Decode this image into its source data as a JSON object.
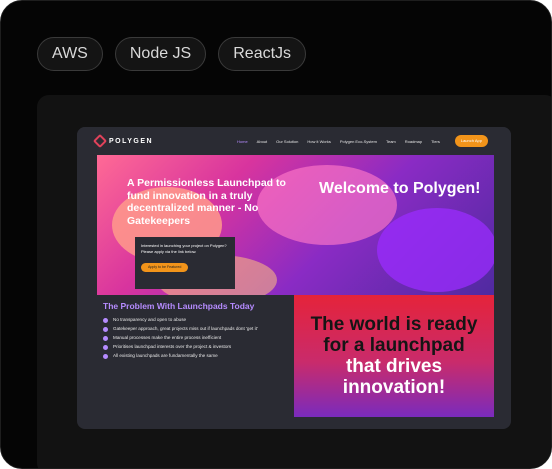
{
  "tags": [
    "AWS",
    "Node JS",
    "ReactJs"
  ],
  "site": {
    "logo_text": "POLYGEN",
    "nav": [
      "Home",
      "About",
      "Our Solution",
      "How it Works",
      "Polygen Eco-System",
      "Team",
      "Roadmap",
      "Tiers"
    ],
    "launch_label": "Launch App",
    "hero_left": "A Permissionless Launchpad to fund innovation in a truly decentralized manner - No Gatekeepers",
    "hero_right": "Welcome to Polygen!",
    "cta_text": "Interested in launching your project on Polygen? Please apply via the link below.",
    "cta_button": "Apply to be Featured",
    "problems_title": "The Problem With Launchpads Today",
    "problems": [
      "No transparency and open to abuse",
      "Gatekeeper approach, great projects miss out if launchpads dont 'get it'",
      "Manual processes make the entire process inefficient",
      "Prioritises launchpad interests over the project & investors",
      "All existing launchpads are fundamentally the same"
    ],
    "big_dark": "The world is ready for a launchpad",
    "big_white": "that drives innovation!"
  },
  "colors": {
    "accent": "#b58bff",
    "cta": "#f2941a",
    "brand": "#e0425a"
  }
}
